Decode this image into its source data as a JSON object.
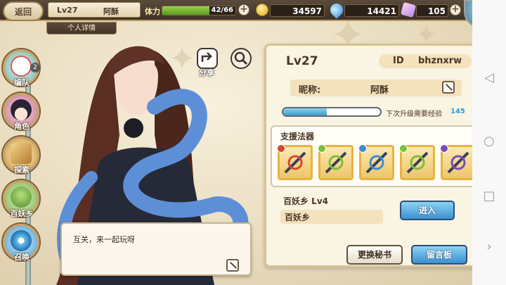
{
  "topbar": {
    "back_label": "返回",
    "level": "Lv27",
    "nickname": "阿酥",
    "stamina_label": "体力",
    "stamina_text": "42/66",
    "stamina_fraction": 0.64,
    "gold": "34597",
    "water": "14421",
    "crystal": "105",
    "profile_tab": "个人详情"
  },
  "left_menu": {
    "items": [
      {
        "label": "编队",
        "icon": "formation-icon"
      },
      {
        "label": "角色",
        "icon": "character-icon"
      },
      {
        "label": "探索",
        "icon": "explore-icon"
      },
      {
        "label": "百妖乡",
        "icon": "demon-village-icon"
      },
      {
        "label": "召唤",
        "icon": "summon-icon"
      }
    ],
    "badge": "2"
  },
  "actions": {
    "share_label": "分享"
  },
  "dialog": {
    "text": "互关，来一起玩呀"
  },
  "panel": {
    "level": "Lv27",
    "id_label": "ID",
    "id_value": "bhznxrw",
    "nickname_label": "昵称:",
    "nickname_value": "阿酥",
    "exp_label": "下次升级需要经验",
    "exp_value": "145",
    "exp_fraction": 0.45,
    "support_title": "支援法器",
    "artifacts": [
      {
        "icon": "red-fan-icon",
        "badge_color": "#d9462b"
      },
      {
        "icon": "crossbow-icon",
        "badge_color": "#7bbf3a"
      },
      {
        "icon": "potion-bottle-icon",
        "badge_color": "#3a8fd0"
      },
      {
        "icon": "golden-ring-icon",
        "badge_color": "#7bbf3a"
      },
      {
        "icon": "dagger-icon",
        "badge_color": "#7a4bb8"
      }
    ],
    "village_title": "百妖乡  Lv4",
    "village_name": "百妖乡",
    "enter_label": "进入",
    "change_secretary_label": "更换秘书",
    "message_board_label": "留言板"
  },
  "colors": {
    "accent_blue": "#3c8fd0",
    "gold_border": "#d9c292",
    "exp_value_color": "#2a9fd6"
  }
}
